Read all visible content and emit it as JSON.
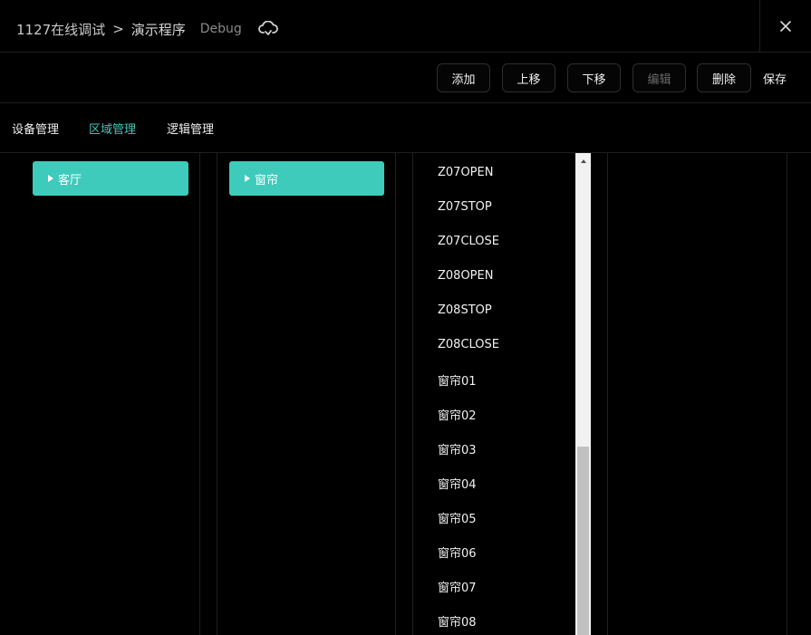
{
  "header": {
    "project": "1127在线调试",
    "separator": ">",
    "program": "演示程序",
    "mode": "Debug",
    "icons": {
      "cloud": "cloud-sync-icon",
      "close": "close-icon"
    }
  },
  "toolbar": {
    "add_label": "添加",
    "move_up_label": "上移",
    "move_down_label": "下移",
    "edit_label": "编辑",
    "delete_label": "删除",
    "save_label": "保存"
  },
  "tabs": [
    {
      "label": "设备管理",
      "active": false
    },
    {
      "label": "区域管理",
      "active": true
    },
    {
      "label": "逻辑管理",
      "active": false
    }
  ],
  "columns": {
    "area": {
      "node_label": "客厅"
    },
    "group": {
      "node_label": "窗帘"
    }
  },
  "commands": [
    "Z07OPEN",
    "Z07STOP",
    "Z07CLOSE",
    "Z08OPEN",
    "Z08STOP",
    "Z08CLOSE",
    "窗帘01",
    "窗帘02",
    "窗帘03",
    "窗帘04",
    "窗帘05",
    "窗帘06",
    "窗帘07",
    "窗帘08"
  ],
  "colors": {
    "accent": "#3ecbbb",
    "active_tab": "#3ec8b7",
    "background": "#000000"
  }
}
